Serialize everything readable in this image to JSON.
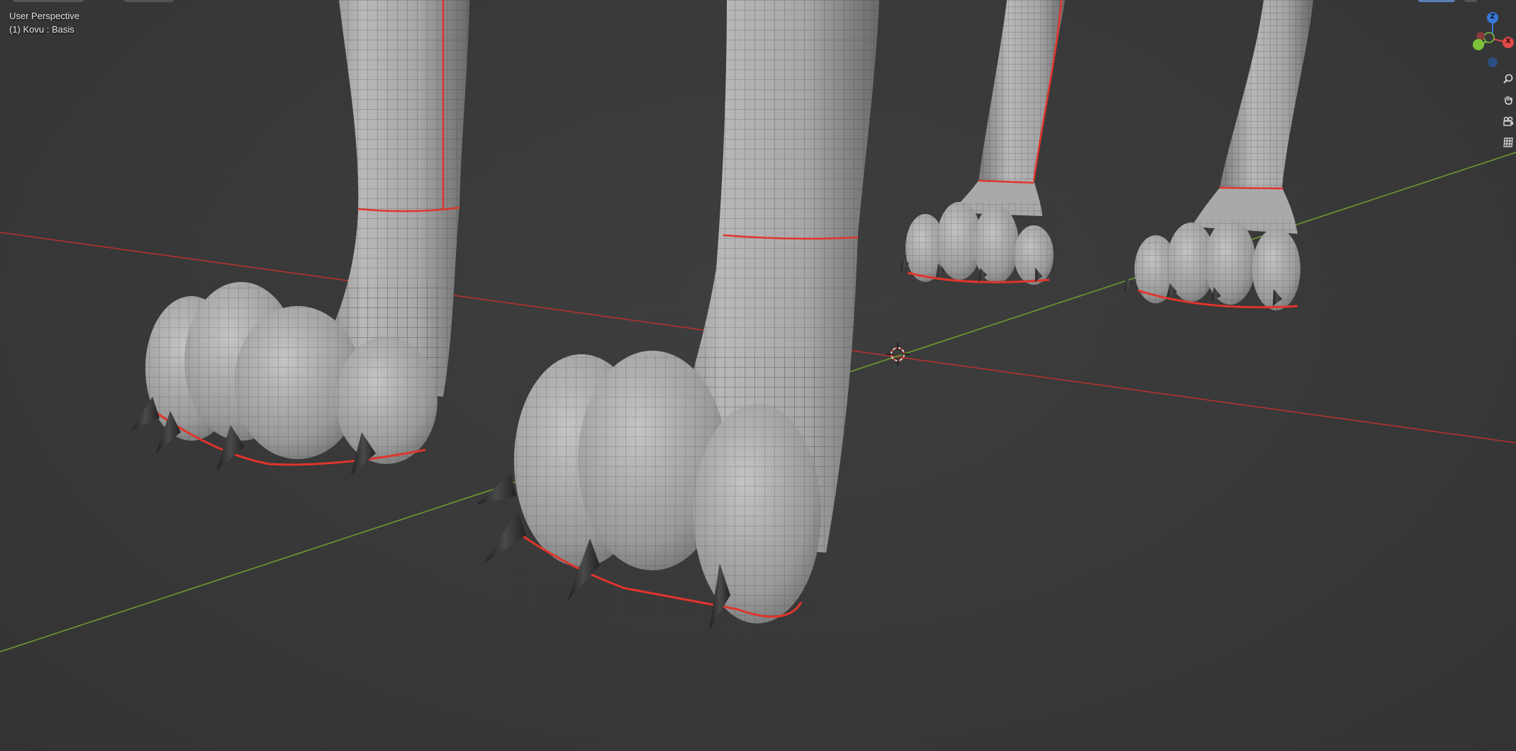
{
  "viewport": {
    "view_name": "User Perspective",
    "object_name": "(1) Kovu : Basis",
    "background_color": "#3a3a3a",
    "axis_x_color": "#b3322f",
    "axis_y_color": "#6e9a2c",
    "seam_color": "#e0352b",
    "mesh_color": "#a8a8a8",
    "wire_color": "#2a2a2a"
  },
  "gizmo": {
    "z_label": "Z",
    "x_label": "X",
    "z_color": "#3a78d8",
    "x_color": "#e04a4a",
    "y_color": "#7cc23c"
  },
  "nav_buttons": [
    {
      "name": "zoom-icon"
    },
    {
      "name": "hand-pan-icon"
    },
    {
      "name": "camera-icon"
    },
    {
      "name": "grid-icon"
    }
  ]
}
